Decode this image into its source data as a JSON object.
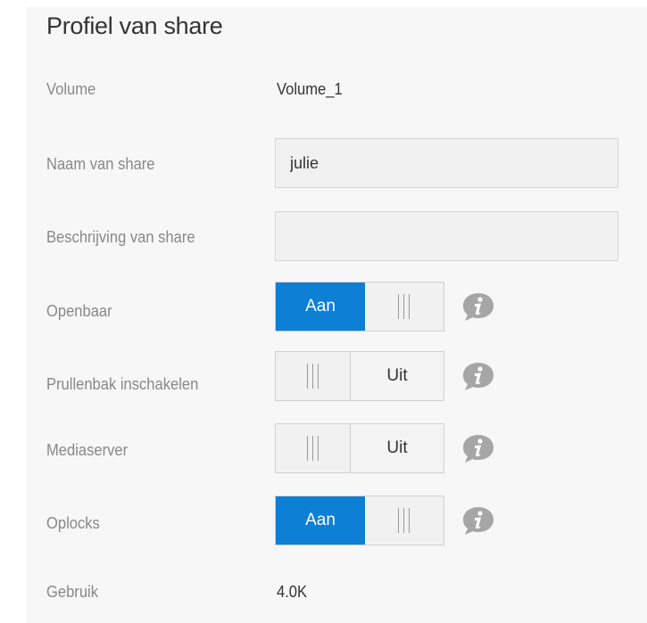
{
  "header": {
    "title": "Profiel van share"
  },
  "fields": {
    "volume": {
      "label": "Volume",
      "value": "Volume_1"
    },
    "share_name": {
      "label": "Naam van share",
      "value": "julie",
      "placeholder": ""
    },
    "share_description": {
      "label": "Beschrijving van share",
      "value": "",
      "placeholder": ""
    },
    "public": {
      "label": "Openbaar",
      "state": "Aan"
    },
    "recycle_bin": {
      "label": "Prullenbak inschakelen",
      "state": "Uit"
    },
    "media_server": {
      "label": "Mediaserver",
      "state": "Uit"
    },
    "oplocks": {
      "label": "Oplocks",
      "state": "Aan"
    },
    "usage": {
      "label": "Gebruik",
      "value": "4.0K"
    }
  },
  "colors": {
    "toggle_on": "#0d7fd5",
    "info_icon": "#a6a6a6",
    "panel_bg": "#f7f7f7"
  }
}
